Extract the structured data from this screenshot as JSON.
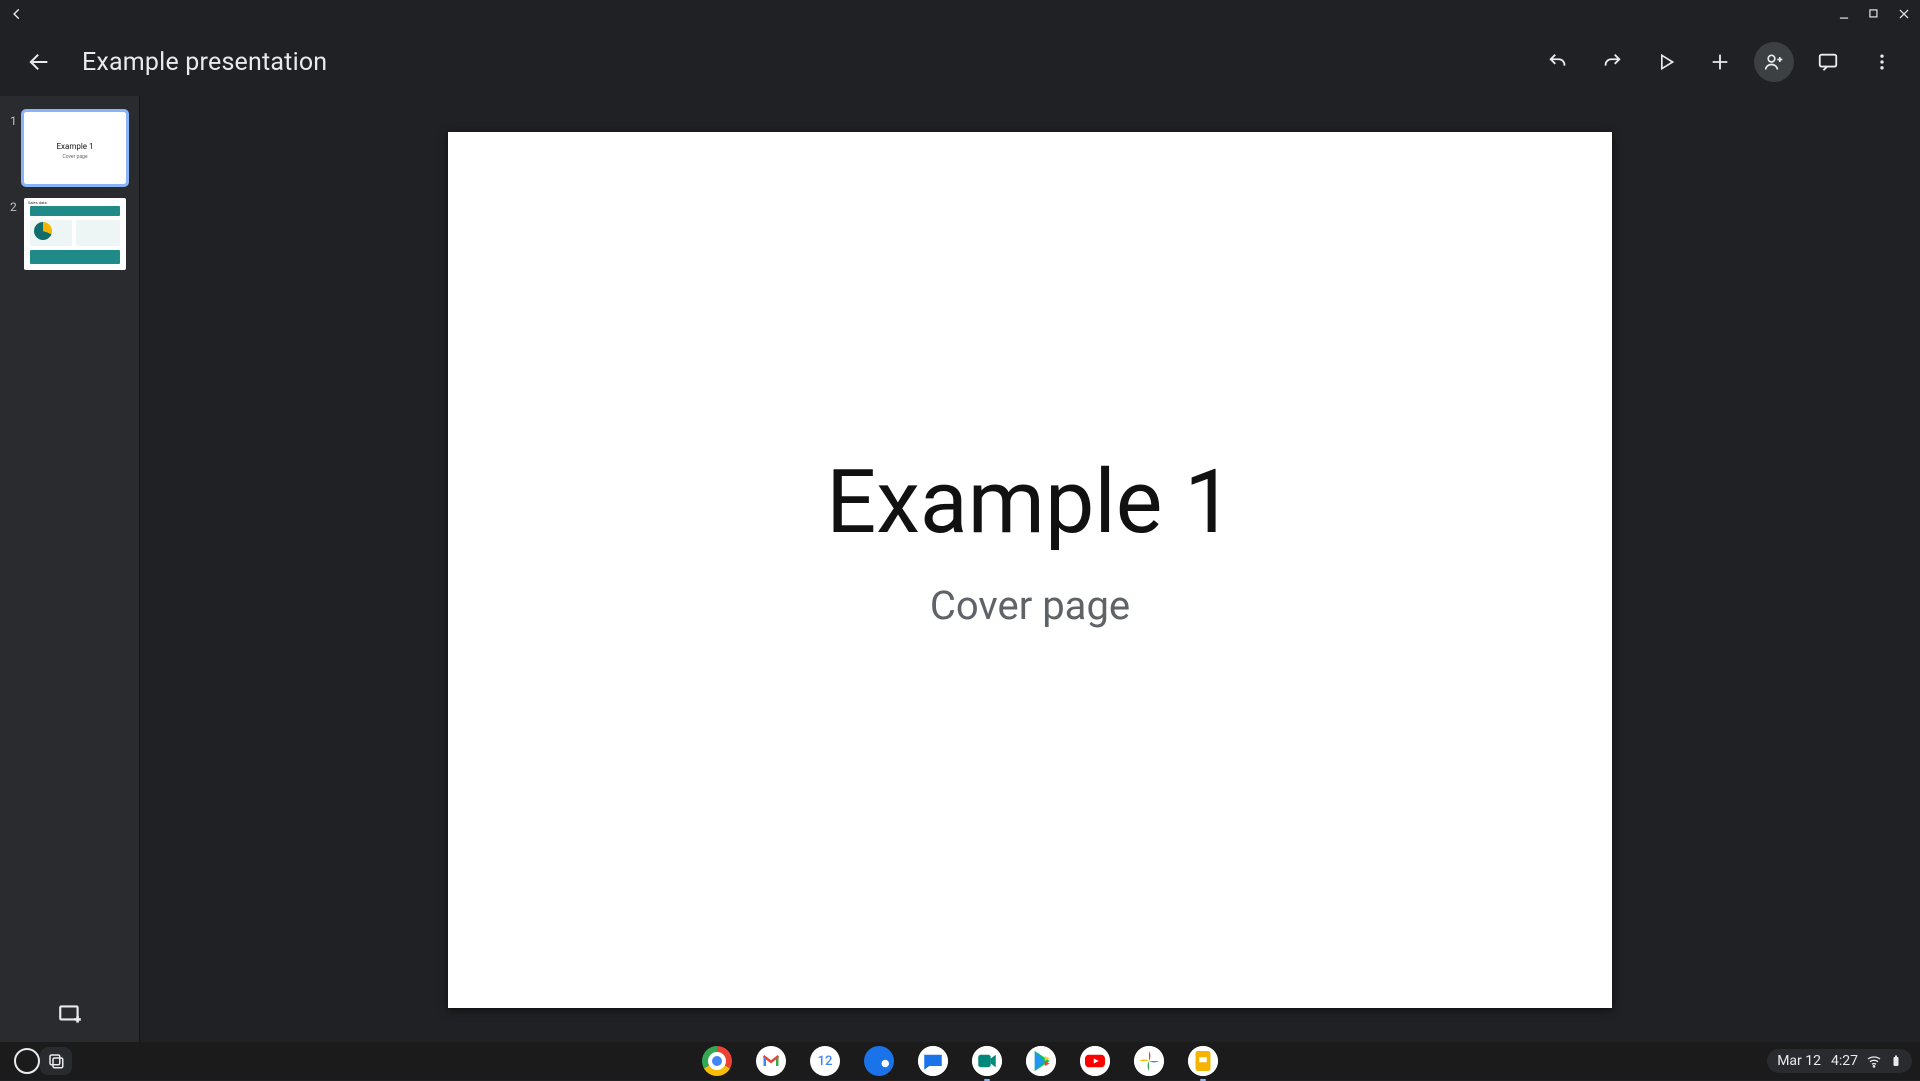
{
  "presentation": {
    "title": "Example presentation"
  },
  "slides": [
    {
      "number": "1",
      "title": "Example 1",
      "subtitle": "Cover page",
      "selected": true
    },
    {
      "number": "2",
      "title": "Sales data",
      "subtitle": "",
      "selected": false
    }
  ],
  "current_slide": {
    "title": "Example 1",
    "subtitle": "Cover page"
  },
  "shelf": {
    "date": "Mar 12",
    "time": "4:27",
    "calendar_day": "12"
  }
}
